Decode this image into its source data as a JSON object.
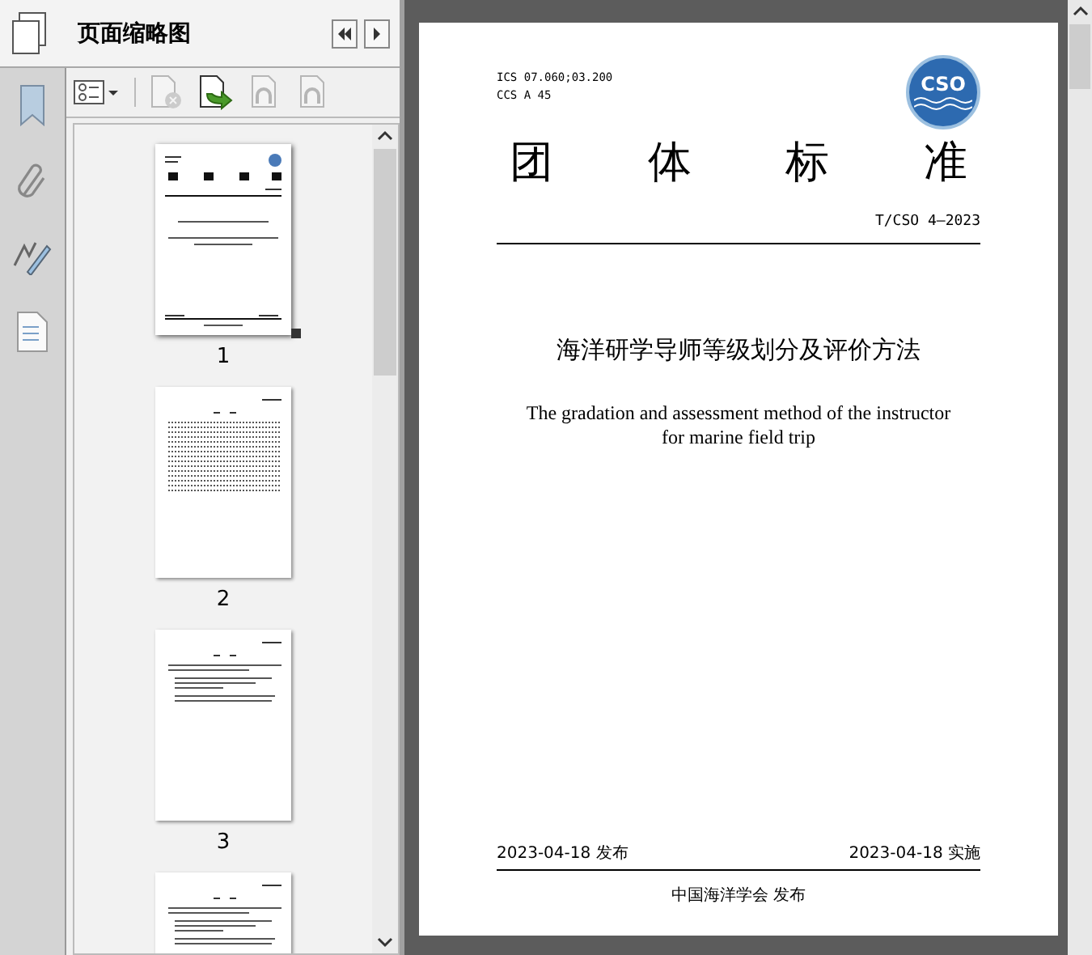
{
  "panel": {
    "title": "页面缩略图"
  },
  "sidebar": [
    {
      "kind": "bookmark"
    },
    {
      "kind": "attachment"
    },
    {
      "kind": "signature"
    },
    {
      "kind": "document"
    }
  ],
  "tools": [
    {
      "kind": "options",
      "disabled": false
    },
    {
      "kind": "delete",
      "disabled": true
    },
    {
      "kind": "insert",
      "disabled": false
    },
    {
      "kind": "undo",
      "disabled": true
    },
    {
      "kind": "redo",
      "disabled": true
    }
  ],
  "thumbnails": [
    {
      "kind": "cover",
      "label": "1",
      "selected": true
    },
    {
      "kind": "contents",
      "label": "2",
      "selected": false
    },
    {
      "kind": "text",
      "label": "3",
      "selected": false
    },
    {
      "kind": "text",
      "selected": false
    }
  ],
  "document": {
    "ics": "ICS 07.060;03.200",
    "ccs": "CCS A 45",
    "logo": "CSO",
    "heading": "团体标准",
    "number": "T/CSO 4—2023",
    "title_cn": "海洋研学导师等级划分及评价方法",
    "title_en": "The gradation and assessment method of the instructor for marine field trip",
    "publish_date": "2023-04-18 发布",
    "implement_date": "2023-04-18 实施",
    "publisher": "中国海洋学会 发布"
  }
}
